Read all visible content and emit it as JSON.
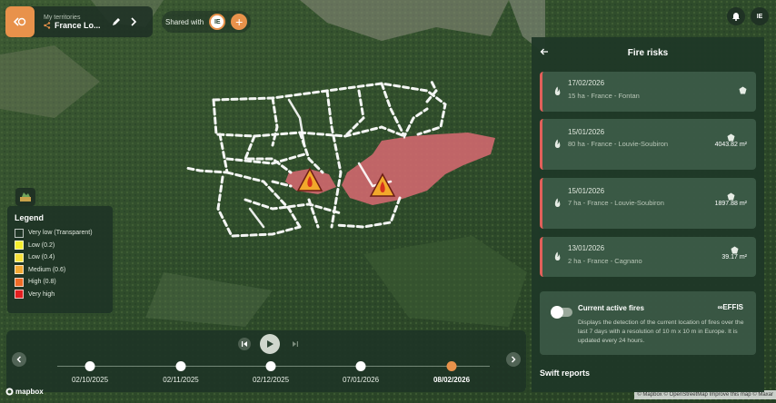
{
  "header": {
    "territory_label": "My territories",
    "territory_name": "France Lo...",
    "shared_with_label": "Shared with",
    "shared_avatar": "IE",
    "user_avatar": "IE"
  },
  "icons": {
    "back": "home-arrow-icon",
    "edit": "pencil-icon",
    "next": "chevron-right-icon",
    "notifications": "bell-icon",
    "legend_toggle": "layers-icon"
  },
  "legend": {
    "title": "Legend",
    "items": [
      {
        "label": "Very low (Transparent)",
        "color": "transparent"
      },
      {
        "label": "Low (0.2)",
        "color": "#f5ef2c"
      },
      {
        "label": "Low (0.4)",
        "color": "#f8e03a"
      },
      {
        "label": "Medium (0.6)",
        "color": "#f2a833"
      },
      {
        "label": "High (0.8)",
        "color": "#ef6b26"
      },
      {
        "label": "Very high",
        "color": "#e31f1f"
      }
    ]
  },
  "timeline": {
    "dates": [
      "02/10/2025",
      "02/11/2025",
      "02/12/2025",
      "07/01/2026",
      "08/02/2026"
    ],
    "active_index": 4
  },
  "panel": {
    "title": "Fire risks",
    "fires": [
      {
        "date": "17/02/2026",
        "desc": "15 ha - France - Fontan",
        "area": ""
      },
      {
        "date": "15/01/2026",
        "desc": "80 ha - France - Louvie-Soubiron",
        "area": "4043.82 m²"
      },
      {
        "date": "15/01/2026",
        "desc": "7 ha - France - Louvie-Soubiron",
        "area": "1897.88 m²"
      },
      {
        "date": "13/01/2026",
        "desc": "2 ha - France - Cagnano",
        "area": "39.17 m²"
      }
    ],
    "active_fires": {
      "title": "Current active fires",
      "source": "EFFIS",
      "description": "Displays the detection of the current location of fires over the last 7 days with a resolution of 10 m x 10 m in Europe. It is updated every 24 hours."
    },
    "next_section": "Swift reports"
  },
  "footer": {
    "mapbox": "mapbox",
    "attribution": "© Mapbox © OpenStreetMap Improve this map © Maxar"
  },
  "colors": {
    "accent": "#e8924b",
    "fire_zone": "#e0707a",
    "panel_bg": "#1f3828",
    "card_border": "#e2605a"
  }
}
